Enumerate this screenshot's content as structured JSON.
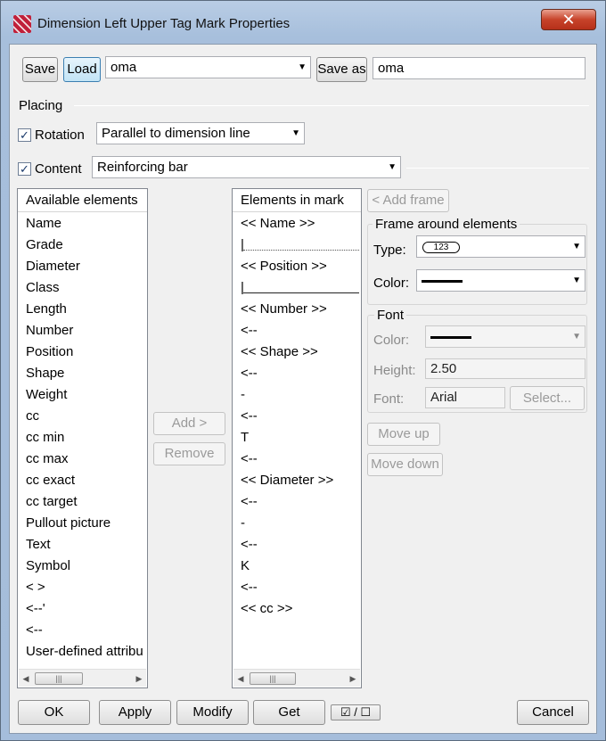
{
  "window": {
    "title": "Dimension Left Upper Tag Mark Properties",
    "close_glyph": "✕"
  },
  "toolbar": {
    "save_label": "Save",
    "load_label": "Load",
    "preset_value": "oma",
    "save_as_label": "Save as",
    "save_as_value": "oma"
  },
  "placing": {
    "section_label": "Placing",
    "rotation_label": "Rotation",
    "rotation_checked": "✓",
    "rotation_value": "Parallel to dimension line",
    "content_label": "Content",
    "content_checked": "✓",
    "content_value": "Reinforcing bar"
  },
  "available": {
    "header": "Available elements",
    "items": [
      "Name",
      "Grade",
      "Diameter",
      "Class",
      "Length",
      "Number",
      "Position",
      "Shape",
      "Weight",
      "cc",
      "cc min",
      "cc max",
      "cc exact",
      "cc target",
      "Pullout picture",
      "Text",
      "Symbol",
      "<  >",
      "<--'",
      "<--",
      "User-defined attribu"
    ]
  },
  "middle_buttons": {
    "add_label": "Add >",
    "remove_label": "Remove"
  },
  "in_mark": {
    "header": "Elements in mark",
    "items": [
      "<< Name >>",
      "|",
      "<< Position >>",
      "|",
      "<< Number >>",
      "<--",
      "<< Shape >>",
      "<--",
      "-",
      "<--",
      "T",
      "<--",
      "<< Diameter >>",
      "<--",
      "-",
      "<--",
      "K",
      "<--",
      "<< cc >>"
    ]
  },
  "frame": {
    "add_frame_label": "< Add frame",
    "group_title": "Frame around elements",
    "type_label": "Type:",
    "type_value": "123",
    "color_label": "Color:"
  },
  "font": {
    "group_title": "Font",
    "color_label": "Color:",
    "height_label": "Height:",
    "height_value": "2.50",
    "font_label": "Font:",
    "font_value": "Arial",
    "select_label": "Select..."
  },
  "move": {
    "up_label": "Move up",
    "down_label": "Move down"
  },
  "footer": {
    "ok_label": "OK",
    "apply_label": "Apply",
    "modify_label": "Modify",
    "get_label": "Get",
    "toggle_label": "☑ / ☐",
    "cancel_label": "Cancel"
  },
  "scroll_glyphs": {
    "left": "◀",
    "right": "▶",
    "grip": "|||",
    "dropdown": "▼"
  }
}
